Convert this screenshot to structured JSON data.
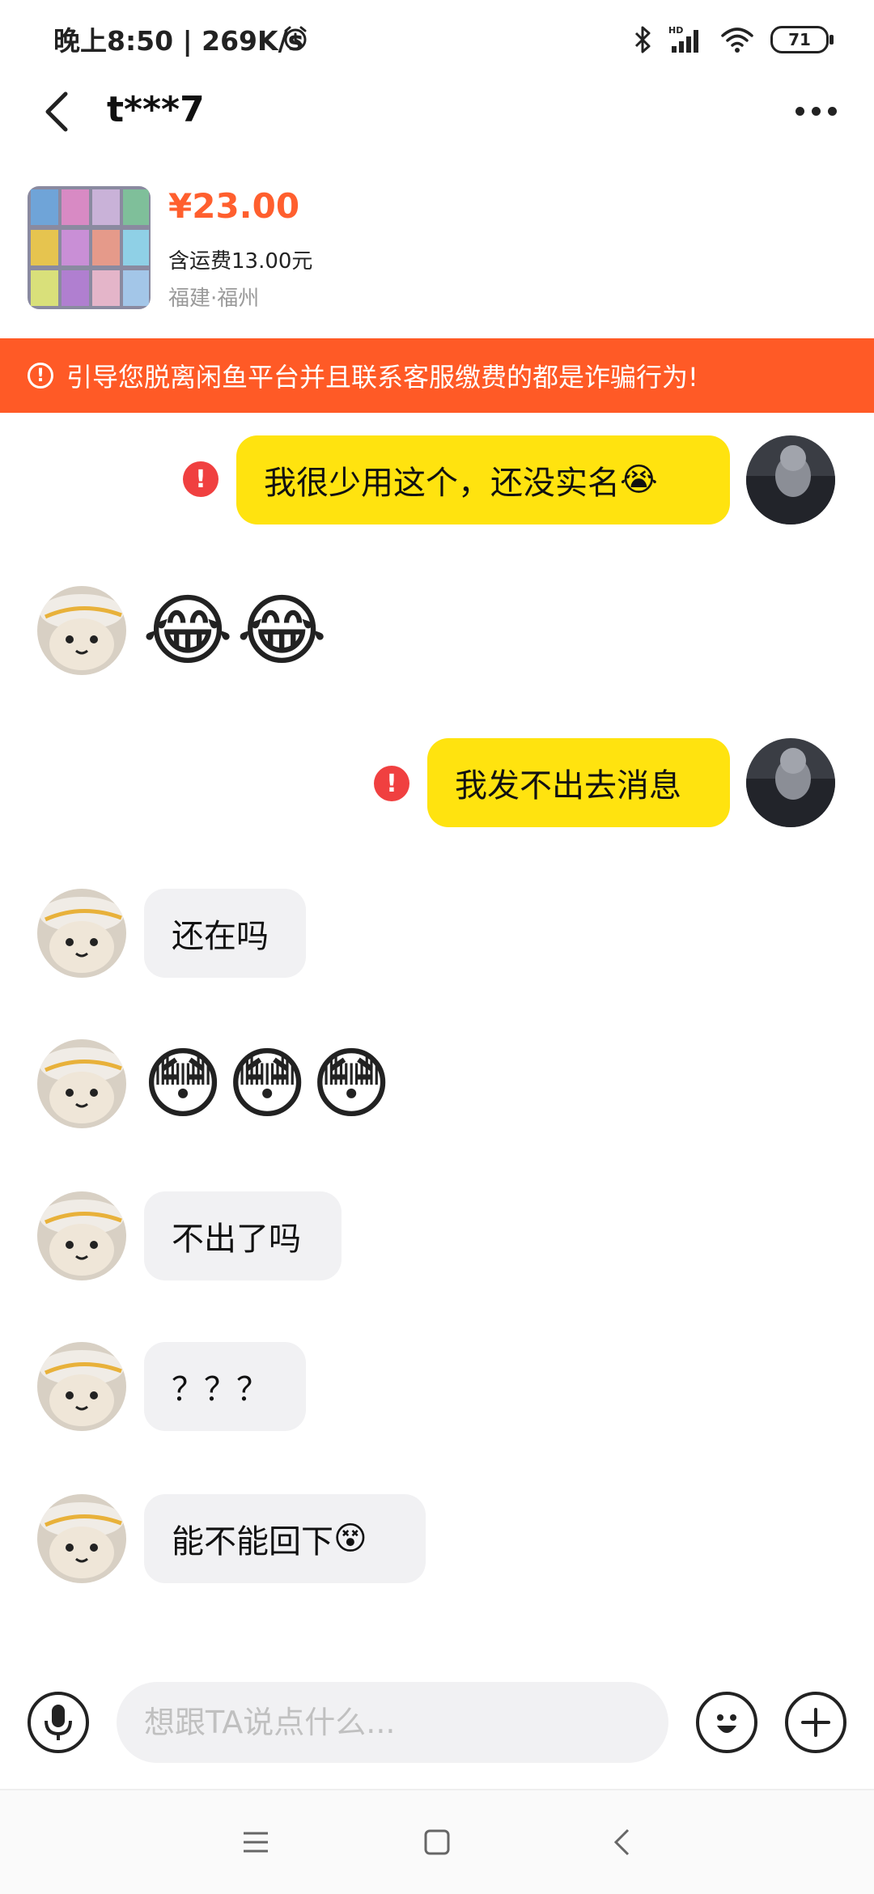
{
  "status_bar": {
    "time_speed": "晚上8:50 | 269K/s",
    "battery": "71",
    "icons": [
      "alarm-icon",
      "bluetooth-icon",
      "hd-signal-icon",
      "wifi-icon",
      "battery-icon"
    ]
  },
  "header": {
    "back_icon": "chevron-left-icon",
    "title": "t***7",
    "more_icon": "more-dots-icon"
  },
  "product": {
    "price": "¥23.00",
    "shipping": "含运费13.00元",
    "location": "福建·福州"
  },
  "warning": {
    "text": "引导您脱离闲鱼平台并且联系客服缴费的都是诈骗行为!"
  },
  "messages": [
    {
      "side": "me",
      "type": "text",
      "text": "我很少用这个，还没实名",
      "failed": true
    },
    {
      "side": "other",
      "type": "emoji",
      "emojis": [
        "😂",
        "😂"
      ]
    },
    {
      "side": "me",
      "type": "text",
      "text": "我发不出去消息",
      "failed": true
    },
    {
      "side": "other",
      "type": "text",
      "text": "还在吗"
    },
    {
      "side": "other",
      "type": "emoji",
      "emojis": [
        "😳",
        "😳",
        "😳"
      ]
    },
    {
      "side": "other",
      "type": "text",
      "text": "不出了吗"
    },
    {
      "side": "other",
      "type": "text",
      "text": "？？？"
    },
    {
      "side": "other",
      "type": "text",
      "text": "能不能回下"
    }
  ],
  "input": {
    "placeholder": "想跟TA说点什么..."
  },
  "nav": [
    "menu-icon",
    "home-icon",
    "back-icon"
  ]
}
